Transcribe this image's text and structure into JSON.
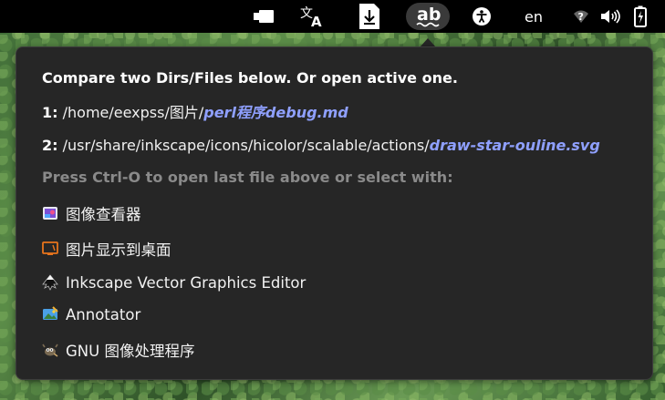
{
  "topbar": {
    "language": "en",
    "icons": [
      "screen-record-icon",
      "translate-icon",
      "download-icon",
      "ocr-translate-icon",
      "accessibility-icon",
      "wifi-icon",
      "volume-icon",
      "battery-icon"
    ]
  },
  "popup": {
    "heading": "Compare two Dirs/Files below. Or open active one.",
    "entries": [
      {
        "num": "1:",
        "path": " /home/eexpss/图片/",
        "file": "perl程序debug.md"
      },
      {
        "num": "2:",
        "path": " /usr/share/inkscape/icons/hicolor/scalable/actions/",
        "file": "draw-star-ouline.svg"
      }
    ],
    "hint": "Press Ctrl-O to open last file above or select with:",
    "apps": [
      {
        "label": "图像查看器",
        "icon": "image-viewer-icon"
      },
      {
        "label": "图片显示到桌面",
        "icon": "desktop-display-icon"
      },
      {
        "label": "Inkscape Vector Graphics Editor",
        "icon": "inkscape-icon"
      },
      {
        "label": "Annotator",
        "icon": "annotator-icon"
      },
      {
        "label": "GNU 图像处理程序",
        "icon": "gimp-icon"
      }
    ]
  },
  "colors": {
    "popup_bg": "#262626",
    "file_accent": "#8fa0ff",
    "hint": "#8a8a8a",
    "topbar_bg": "#000000"
  }
}
